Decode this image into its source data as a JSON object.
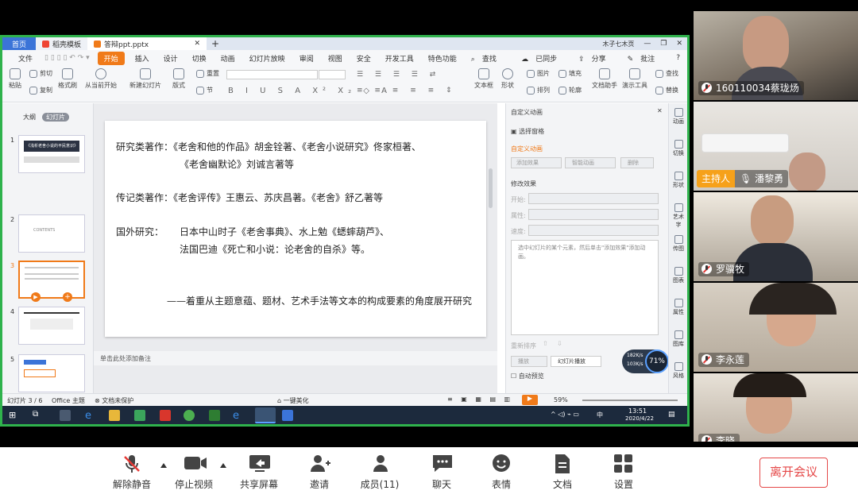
{
  "wps": {
    "tabs": [
      {
        "label": "首页"
      },
      {
        "label": "稻壳模板"
      },
      {
        "label": "答辩ppt.pptx"
      }
    ],
    "user": "木子七木页",
    "menu": [
      "文件",
      "开始",
      "插入",
      "设计",
      "切换",
      "动画",
      "幻灯片放映",
      "审阅",
      "视图",
      "安全",
      "开发工具",
      "特色功能",
      "查找"
    ],
    "menu_right": [
      "已同步",
      "分享",
      "批注"
    ],
    "ribbon": {
      "paste": "粘贴",
      "cut": "剪切",
      "copy": "复制",
      "format_painter": "格式刷",
      "from_current": "从当前开始",
      "new_slide": "新建幻灯片",
      "layout": "版式",
      "section": "节",
      "reset": "重置",
      "textbox": "文本框",
      "shape": "形状",
      "arrange": "排列",
      "image": "图片",
      "fill": "填充",
      "outline": "轮廓",
      "doc_assist": "文档助手",
      "present_tools": "演示工具",
      "find": "查找",
      "replace": "替换"
    },
    "left_tabs": {
      "outline": "大纲",
      "slides": "幻灯片"
    },
    "thumbnails": [
      {
        "num": "1",
        "title": "《浅析老舍小说的平民意识》"
      },
      {
        "num": "2",
        "title": "CONTENTS"
      },
      {
        "num": "3",
        "title": ""
      },
      {
        "num": "4",
        "title": ""
      },
      {
        "num": "5",
        "title": ""
      },
      {
        "num": "6",
        "title": ""
      }
    ],
    "slide_lines": [
      "研究类著作：《老舍和他的作品》胡金铨著、《老舍小说研究》佟家桓著、",
      "《老舍幽默论》刘诚言著等",
      "传记类著作：《老舍评传》王惠云、苏庆昌著。《老舍》舒乙著等",
      "国外研究：",
      "日本中山时子《老舍事典》、水上勉《蟋蟀葫芦》、",
      "法国巴迪《死亡和小说：论老舍的自杀》等。",
      "——着重从主题意蕴、题材、艺术手法等文本的构成要素的角度展开研究"
    ],
    "notes_placeholder": "单击此处添加备注",
    "anim_panel": {
      "title": "自定义动画",
      "select_pane": "选择窗格",
      "custom_anim": "自定义动画",
      "add_effect": "添加效果",
      "smart_anim": "智能动画",
      "delete": "删除",
      "modify_effect": "修改效果",
      "start": "开始:",
      "property": "属性:",
      "speed": "速度:",
      "hint": "选中幻灯片的某个元素，然后单击\"添加效果\"添加动画。",
      "reorder": "重新排序",
      "play": "播放",
      "slideshow": "幻灯片播放",
      "autopreview": "自动预览"
    },
    "side_icons": [
      "动画",
      "切换",
      "形状",
      "艺术字",
      "传图",
      "图表",
      "属性",
      "图库",
      "风格"
    ],
    "status": {
      "slide": "幻灯片 3 / 6",
      "theme": "Office 主题",
      "protect": "文档未保护",
      "beautify": "一键美化",
      "zoom": "59%"
    },
    "net": {
      "up": "182K/s",
      "down": "103K/s",
      "pct": "71%"
    },
    "clock": {
      "time": "13:51",
      "date": "2020/4/22"
    },
    "ime": "中"
  },
  "participants": [
    {
      "name": "160110034蔡珑炀",
      "host": false
    },
    {
      "name": "潘黎勇",
      "host": true,
      "host_tag": "主持人"
    },
    {
      "name": "罗骥牧",
      "host": false
    },
    {
      "name": "李永莲",
      "host": false
    },
    {
      "name": "李晓",
      "host": false
    }
  ],
  "toolbar": {
    "unmute": "解除静音",
    "stop_video": "停止视频",
    "share": "共享屏幕",
    "invite": "邀请",
    "members": "成员(11)",
    "chat": "聊天",
    "emoji": "表情",
    "docs": "文档",
    "settings": "设置",
    "leave": "离开会议"
  },
  "colors": {
    "accent": "#f07a19",
    "share_border": "#2fb24c",
    "host": "#f6a11a",
    "leave": "#e54848",
    "taskbar": "#1c2a3d"
  }
}
